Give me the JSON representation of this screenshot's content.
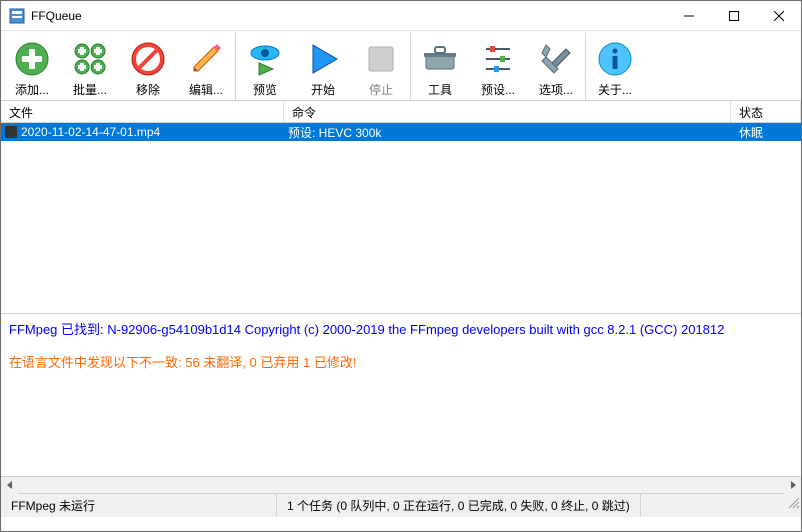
{
  "window": {
    "title": "FFQueue"
  },
  "toolbar": {
    "add": "添加...",
    "batch": "批量...",
    "remove": "移除",
    "edit": "编辑...",
    "preview": "预览",
    "start": "开始",
    "stop": "停止",
    "tools": "工具",
    "presets": "预设...",
    "options": "选项...",
    "about": "关于..."
  },
  "headers": {
    "file": "文件",
    "command": "命令",
    "status": "状态"
  },
  "rows": [
    {
      "file": "2020-11-02-14-47-01.mp4",
      "command": "预设: HEVC 300k",
      "status": "休眠",
      "selected": true
    }
  ],
  "log": {
    "line1": "FFMpeg 已找到: N-92906-g54109b1d14 Copyright (c) 2000-2019 the FFmpeg developers built with gcc 8.2.1 (GCC) 201812",
    "line2": "在语言文件中发现以下不一致: 56 未翻译, 0 已弃用  1 已修改!"
  },
  "statusbar": {
    "ffmpeg": "FFMpeg 未运行",
    "tasks": "1 个任务 (0 队列中, 0 正在运行, 0 已完成, 0 失败, 0 终止, 0 跳过)"
  }
}
